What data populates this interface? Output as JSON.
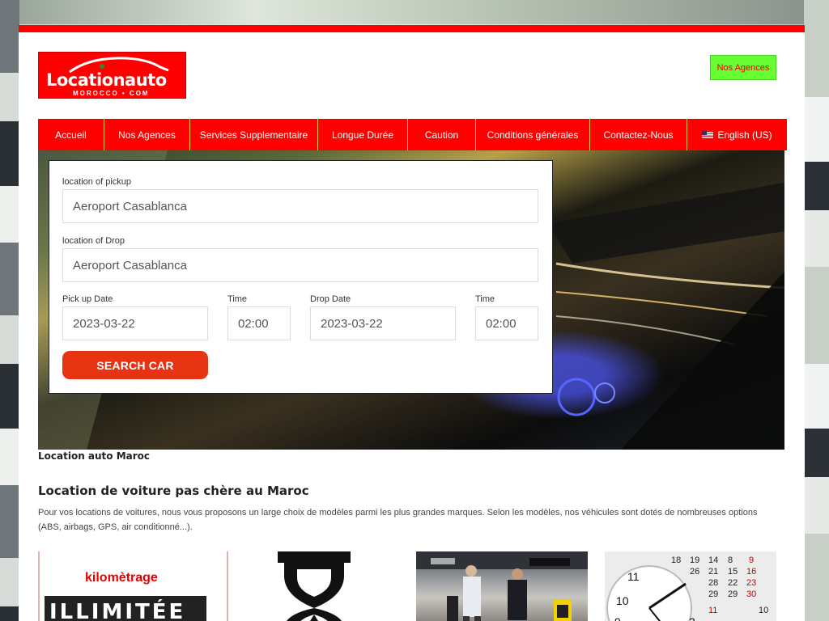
{
  "header": {
    "logo_text": "Locationauto",
    "logo_sub": "MOROCCO • COM",
    "agencies_button": "Nos Agences"
  },
  "nav": {
    "items": [
      {
        "label": "Accueil"
      },
      {
        "label": "Nos Agences"
      },
      {
        "label": "Services Supplementaire"
      },
      {
        "label": "Longue Durée"
      },
      {
        "label": "Caution"
      },
      {
        "label": "Conditions générales"
      },
      {
        "label": "Contactez-Nous"
      },
      {
        "label": "English (US)"
      }
    ]
  },
  "search": {
    "pickup_label": "location of pickup",
    "pickup_value": "Aeroport Casablanca",
    "drop_label": "location of Drop",
    "drop_value": "Aeroport Casablanca",
    "pickup_date_label": "Pick up Date",
    "pickup_date": "2023-03-22",
    "pickup_time_label": "Time",
    "pickup_time": "02:00",
    "drop_date_label": "Drop Date",
    "drop_date": "2023-03-22",
    "drop_time_label": "Time",
    "drop_time": "02:00",
    "search_button": "SEARCH CAR"
  },
  "content": {
    "hero_caption": "Location auto Maroc",
    "heading": "Location de voiture pas chère au Maroc",
    "paragraph": "Pour vos locations de voitures, nous vous proposons un large choix de modèles parmi les plus grandes marques. Selon les modèles, nos véhicules sont dotés de nombreuses options (ABS, airbags, GPS, air conditionné...)."
  },
  "tiles": {
    "km_label": "kilomètrage",
    "unlimited_label": "ILLIMITÉE"
  },
  "colors": {
    "brand_red": "#ff0000",
    "accent_green": "#66ff33",
    "button_red": "#e63312",
    "nav_divider": "#ffcc33"
  }
}
